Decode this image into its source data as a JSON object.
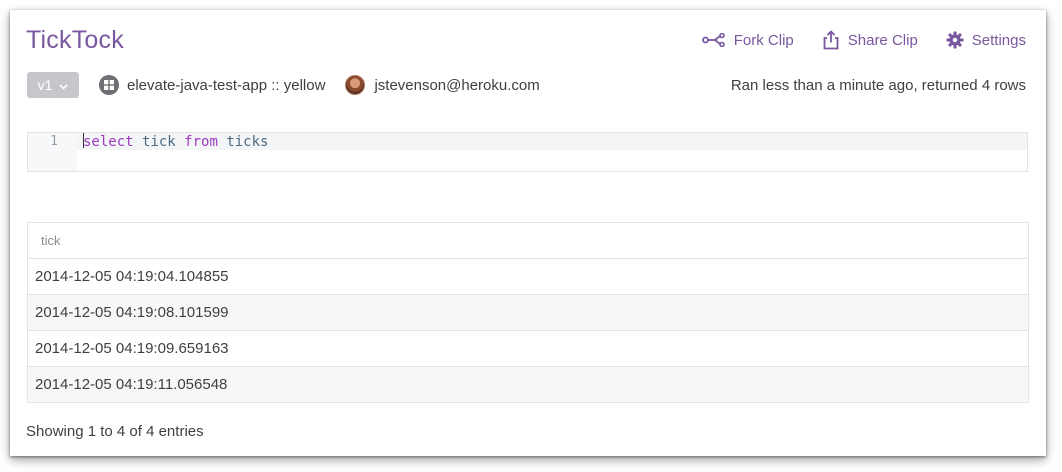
{
  "app": {
    "title": "TickTock",
    "accent_color": "#79589f"
  },
  "toolbar": {
    "fork": {
      "label": "Fork Clip",
      "icon": "fork-icon"
    },
    "share": {
      "label": "Share Clip",
      "icon": "share-icon"
    },
    "settings": {
      "label": "Settings",
      "icon": "gear-icon"
    }
  },
  "meta": {
    "version": "v1",
    "database": "elevate-java-test-app :: yellow",
    "user": "jstevenson@heroku.com",
    "status": "Ran less than a minute ago, returned 4 rows"
  },
  "editor": {
    "line_number": "1",
    "tokens": [
      {
        "text": "select",
        "type": "kw"
      },
      {
        "text": " ",
        "type": "ws"
      },
      {
        "text": "tick",
        "type": "id"
      },
      {
        "text": " ",
        "type": "ws"
      },
      {
        "text": "from",
        "type": "kw"
      },
      {
        "text": " ",
        "type": "ws"
      },
      {
        "text": "ticks",
        "type": "id"
      }
    ]
  },
  "results": {
    "columns": [
      "tick"
    ],
    "rows": [
      [
        "2014-12-05 04:19:04.104855"
      ],
      [
        "2014-12-05 04:19:08.101599"
      ],
      [
        "2014-12-05 04:19:09.659163"
      ],
      [
        "2014-12-05 04:19:11.056548"
      ]
    ],
    "summary": "Showing 1 to 4 of 4 entries"
  }
}
